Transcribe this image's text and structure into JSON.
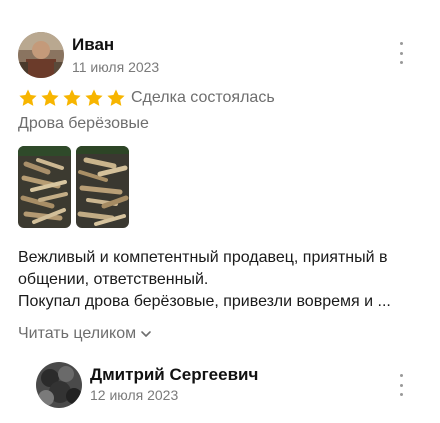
{
  "review1": {
    "author": "Иван",
    "date": "11 июля 2023",
    "rating": 5,
    "rating_max": 5,
    "status": "Сделка состоялась",
    "product": "Дрова берёзовые",
    "text_line1": "Вежливый и компетентный продавец, приятный в",
    "text_line2": "общении, ответственный.",
    "text_line3": "Покупал дрова берёзовые, привезли вовремя и ...",
    "read_more": "Читать целиком",
    "photos": [
      "photo-firewood-1",
      "photo-firewood-2"
    ]
  },
  "review2": {
    "author": "Дмитрий Сергеевич",
    "date": "12 июля 2023"
  },
  "colors": {
    "star": "#f7b500",
    "muted": "#7a7a7a"
  },
  "icons": {
    "more": "more-vertical-icon",
    "chevron": "chevron-down-icon",
    "star": "star-icon"
  }
}
